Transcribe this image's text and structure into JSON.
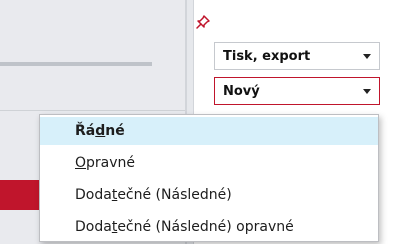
{
  "export_select": {
    "value": "Tisk, export"
  },
  "type_select": {
    "value": "Nový"
  },
  "menu": {
    "items": [
      {
        "pre": "Řá",
        "key": "d",
        "post": "né",
        "selected": true
      },
      {
        "pre": "",
        "key": "O",
        "post": "pravné",
        "selected": false
      },
      {
        "pre": "Doda",
        "key": "t",
        "post": "ečné (Následné)",
        "selected": false
      },
      {
        "pre": "Doda",
        "key": "t",
        "post": "ečné (Následné) opravné",
        "selected": false
      }
    ]
  },
  "colors": {
    "accent": "#c0152c",
    "highlight": "#d7f0fa"
  },
  "icons": {
    "pin": "pin-icon"
  }
}
